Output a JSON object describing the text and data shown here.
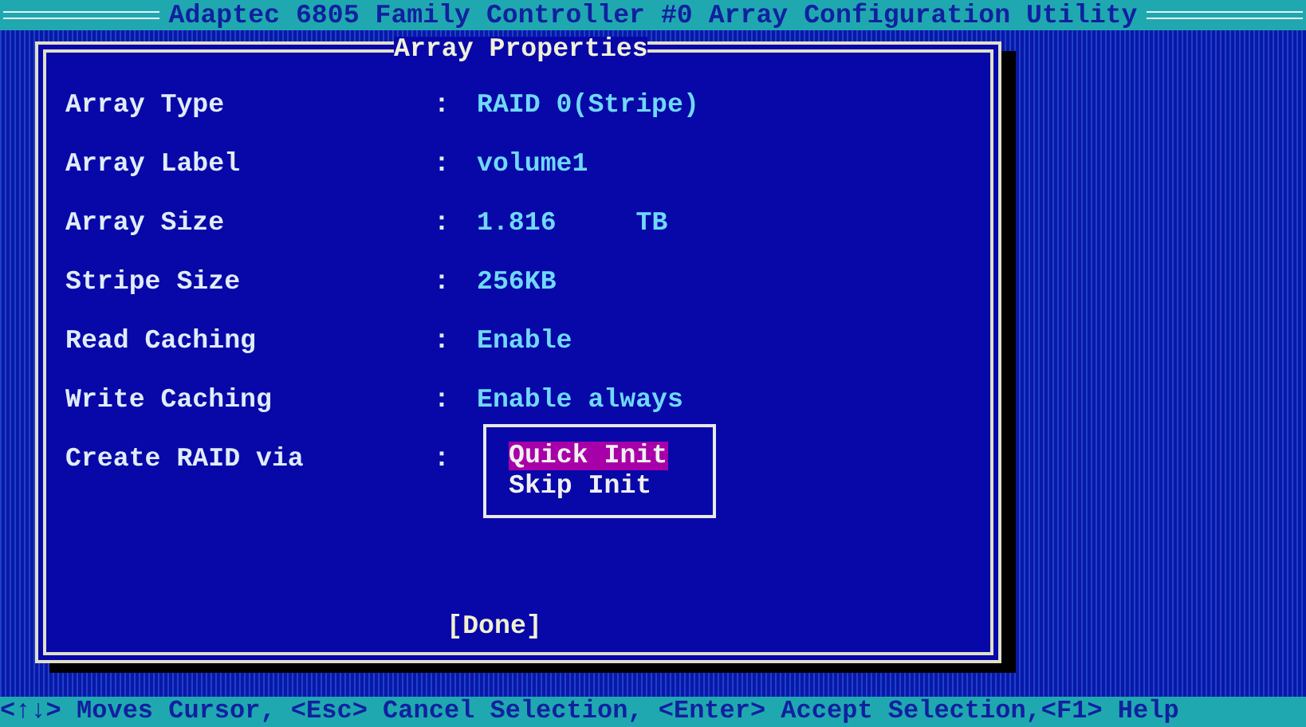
{
  "title_bar": {
    "title": "Adaptec 6805 Family Controller #0 Array Configuration Utility"
  },
  "dialog": {
    "title": "Array Properties",
    "fields": [
      {
        "kind": "value",
        "label": "Array Type",
        "separator": ":",
        "value": "RAID 0(Stripe)"
      },
      {
        "kind": "value",
        "label": "Array Label",
        "separator": ":",
        "value": "volume1"
      },
      {
        "kind": "value",
        "label": "Array Size",
        "separator": ":",
        "value": "1.816",
        "unit": "TB"
      },
      {
        "kind": "value",
        "label": "Stripe Size",
        "separator": ":",
        "value": "256KB"
      },
      {
        "kind": "value",
        "label": "Read Caching",
        "separator": ":",
        "value": "Enable"
      },
      {
        "kind": "value",
        "label": "Write Caching",
        "separator": ":",
        "value": "Enable always"
      },
      {
        "kind": "menu",
        "label": "Create RAID via",
        "separator": ":",
        "options": [
          {
            "label": "Quick Init",
            "selected": true
          },
          {
            "label": "Skip Init",
            "selected": false
          }
        ]
      }
    ],
    "done_button": "[Done]"
  },
  "status_bar": "<↑↓> Moves Cursor, <Esc> Cancel Selection, <Enter> Accept Selection,<F1> Help"
}
